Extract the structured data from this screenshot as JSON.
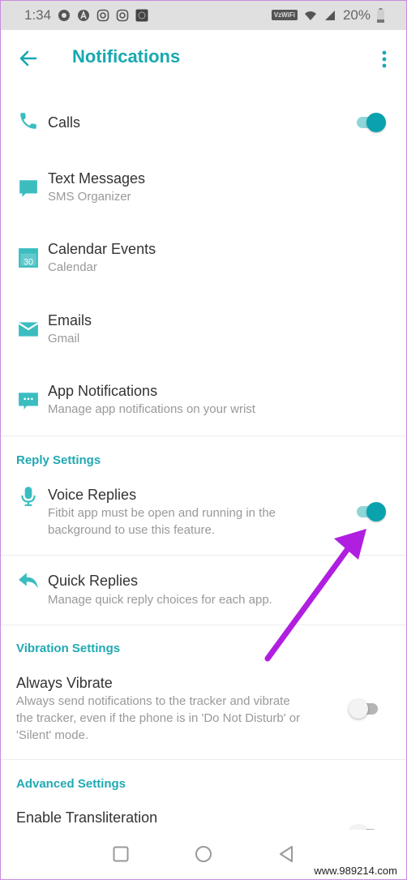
{
  "status_bar": {
    "time": "1:34",
    "network_label": "VzWiFi",
    "battery": "20%"
  },
  "app_bar": {
    "title": "Notifications"
  },
  "items": [
    {
      "title": "Calls",
      "subtitle": "",
      "icon": "phone-icon",
      "toggle": true
    },
    {
      "title": "Text Messages",
      "subtitle": "SMS Organizer",
      "icon": "message-icon"
    },
    {
      "title": "Calendar Events",
      "subtitle": "Calendar",
      "icon": "calendar-icon",
      "icon_text": "30"
    },
    {
      "title": "Emails",
      "subtitle": "Gmail",
      "icon": "mail-icon"
    },
    {
      "title": "App Notifications",
      "subtitle": "Manage app notifications on your wrist",
      "icon": "app-notification-icon"
    }
  ],
  "reply_settings": {
    "header": "Reply Settings",
    "voice_replies": {
      "title": "Voice Replies",
      "subtitle_line1": "Fitbit app must be open and running in the",
      "subtitle_line2": "background to use this feature.",
      "toggle": true
    },
    "quick_replies": {
      "title": "Quick Replies",
      "subtitle": "Manage quick reply choices for each app."
    }
  },
  "vibration_settings": {
    "header": "Vibration Settings",
    "always_vibrate": {
      "title": "Always Vibrate",
      "subtitle_line1": "Always send notifications to the tracker and vibrate",
      "subtitle_line2": "the tracker, even if the phone is in 'Do Not Disturb' or",
      "subtitle_line3": "'Silent' mode.",
      "toggle": false
    }
  },
  "advanced_settings": {
    "header": "Advanced Settings",
    "transliteration": {
      "title": "Enable Transliteration",
      "toggle": false
    }
  },
  "watermark": "www.989214.com",
  "colors": {
    "accent": "#18a8b0",
    "annotation_arrow": "#b01ee0"
  }
}
